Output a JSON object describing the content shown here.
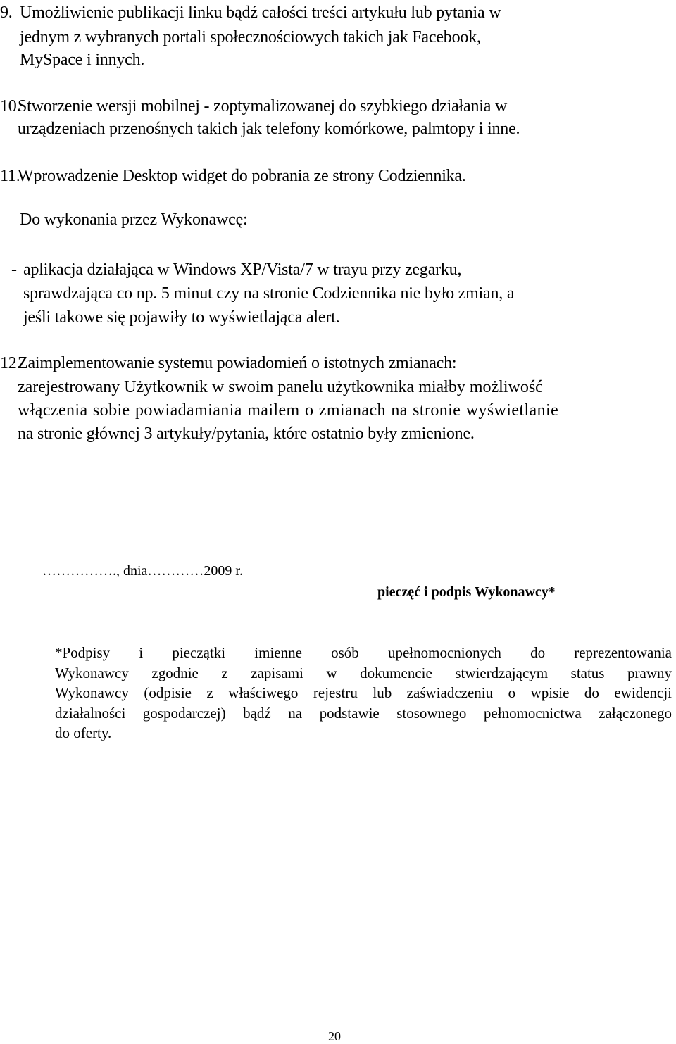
{
  "items": [
    {
      "number": "9.",
      "lines": [
        "Umożliwienie publikacji linku bądź całości treści artykułu lub pytania w",
        "jednym z  wybranych portali społecznościowych takich jak Facebook,",
        "MySpace  i innych."
      ]
    },
    {
      "number": "10.",
      "lines": [
        "Stworzenie wersji mobilnej - zoptymalizowanej do szybkiego działania w",
        "urządzeniach przenośnych takich jak telefony komórkowe, palmtopy  i inne."
      ]
    },
    {
      "number": "11.",
      "lines": [
        "Wprowadzenie Desktop widget do pobrania ze strony Codziennika."
      ]
    },
    {
      "number": "12.",
      "lines": [
        "Zaimplementowanie systemu powiadomień o istotnych zmianach:",
        "zarejestrowany Użytkownik w swoim panelu użytkownika miałby możliwość",
        "włączenia sobie powiadamiania mailem o zmianach na stronie wyświetlanie",
        "na stronie głównej 3 artykuły/pytania, które ostatnio były zmienione."
      ]
    }
  ],
  "contractor_task": {
    "heading": "Do wykonania przez Wykonawcę:",
    "bullet": "-",
    "lines": [
      "aplikacja działająca w Windows XP/Vista/7 w trayu przy zegarku,",
      "sprawdzająca co np. 5 minut czy na stronie Codziennika nie było zmian, a",
      "jeśli takowe się pojawiły to wyświetlająca alert."
    ]
  },
  "signature": {
    "place_date": "……………., dnia…………2009 r.",
    "label": "pieczęć  i podpis Wykonawcy*"
  },
  "footnote": {
    "lines": [
      "*Podpisy i pieczątki imienne osób upełnomocnionych do reprezentowania",
      "Wykonawcy zgodnie z zapisami w dokumencie stwierdzającym status prawny",
      "Wykonawcy (odpisie z właściwego rejestru lub zaświadczeniu o wpisie do ewidencji",
      "działalności gospodarczej) bądź na podstawie stosownego pełnomocnictwa załączonego",
      "do oferty."
    ]
  },
  "page_number": "20"
}
